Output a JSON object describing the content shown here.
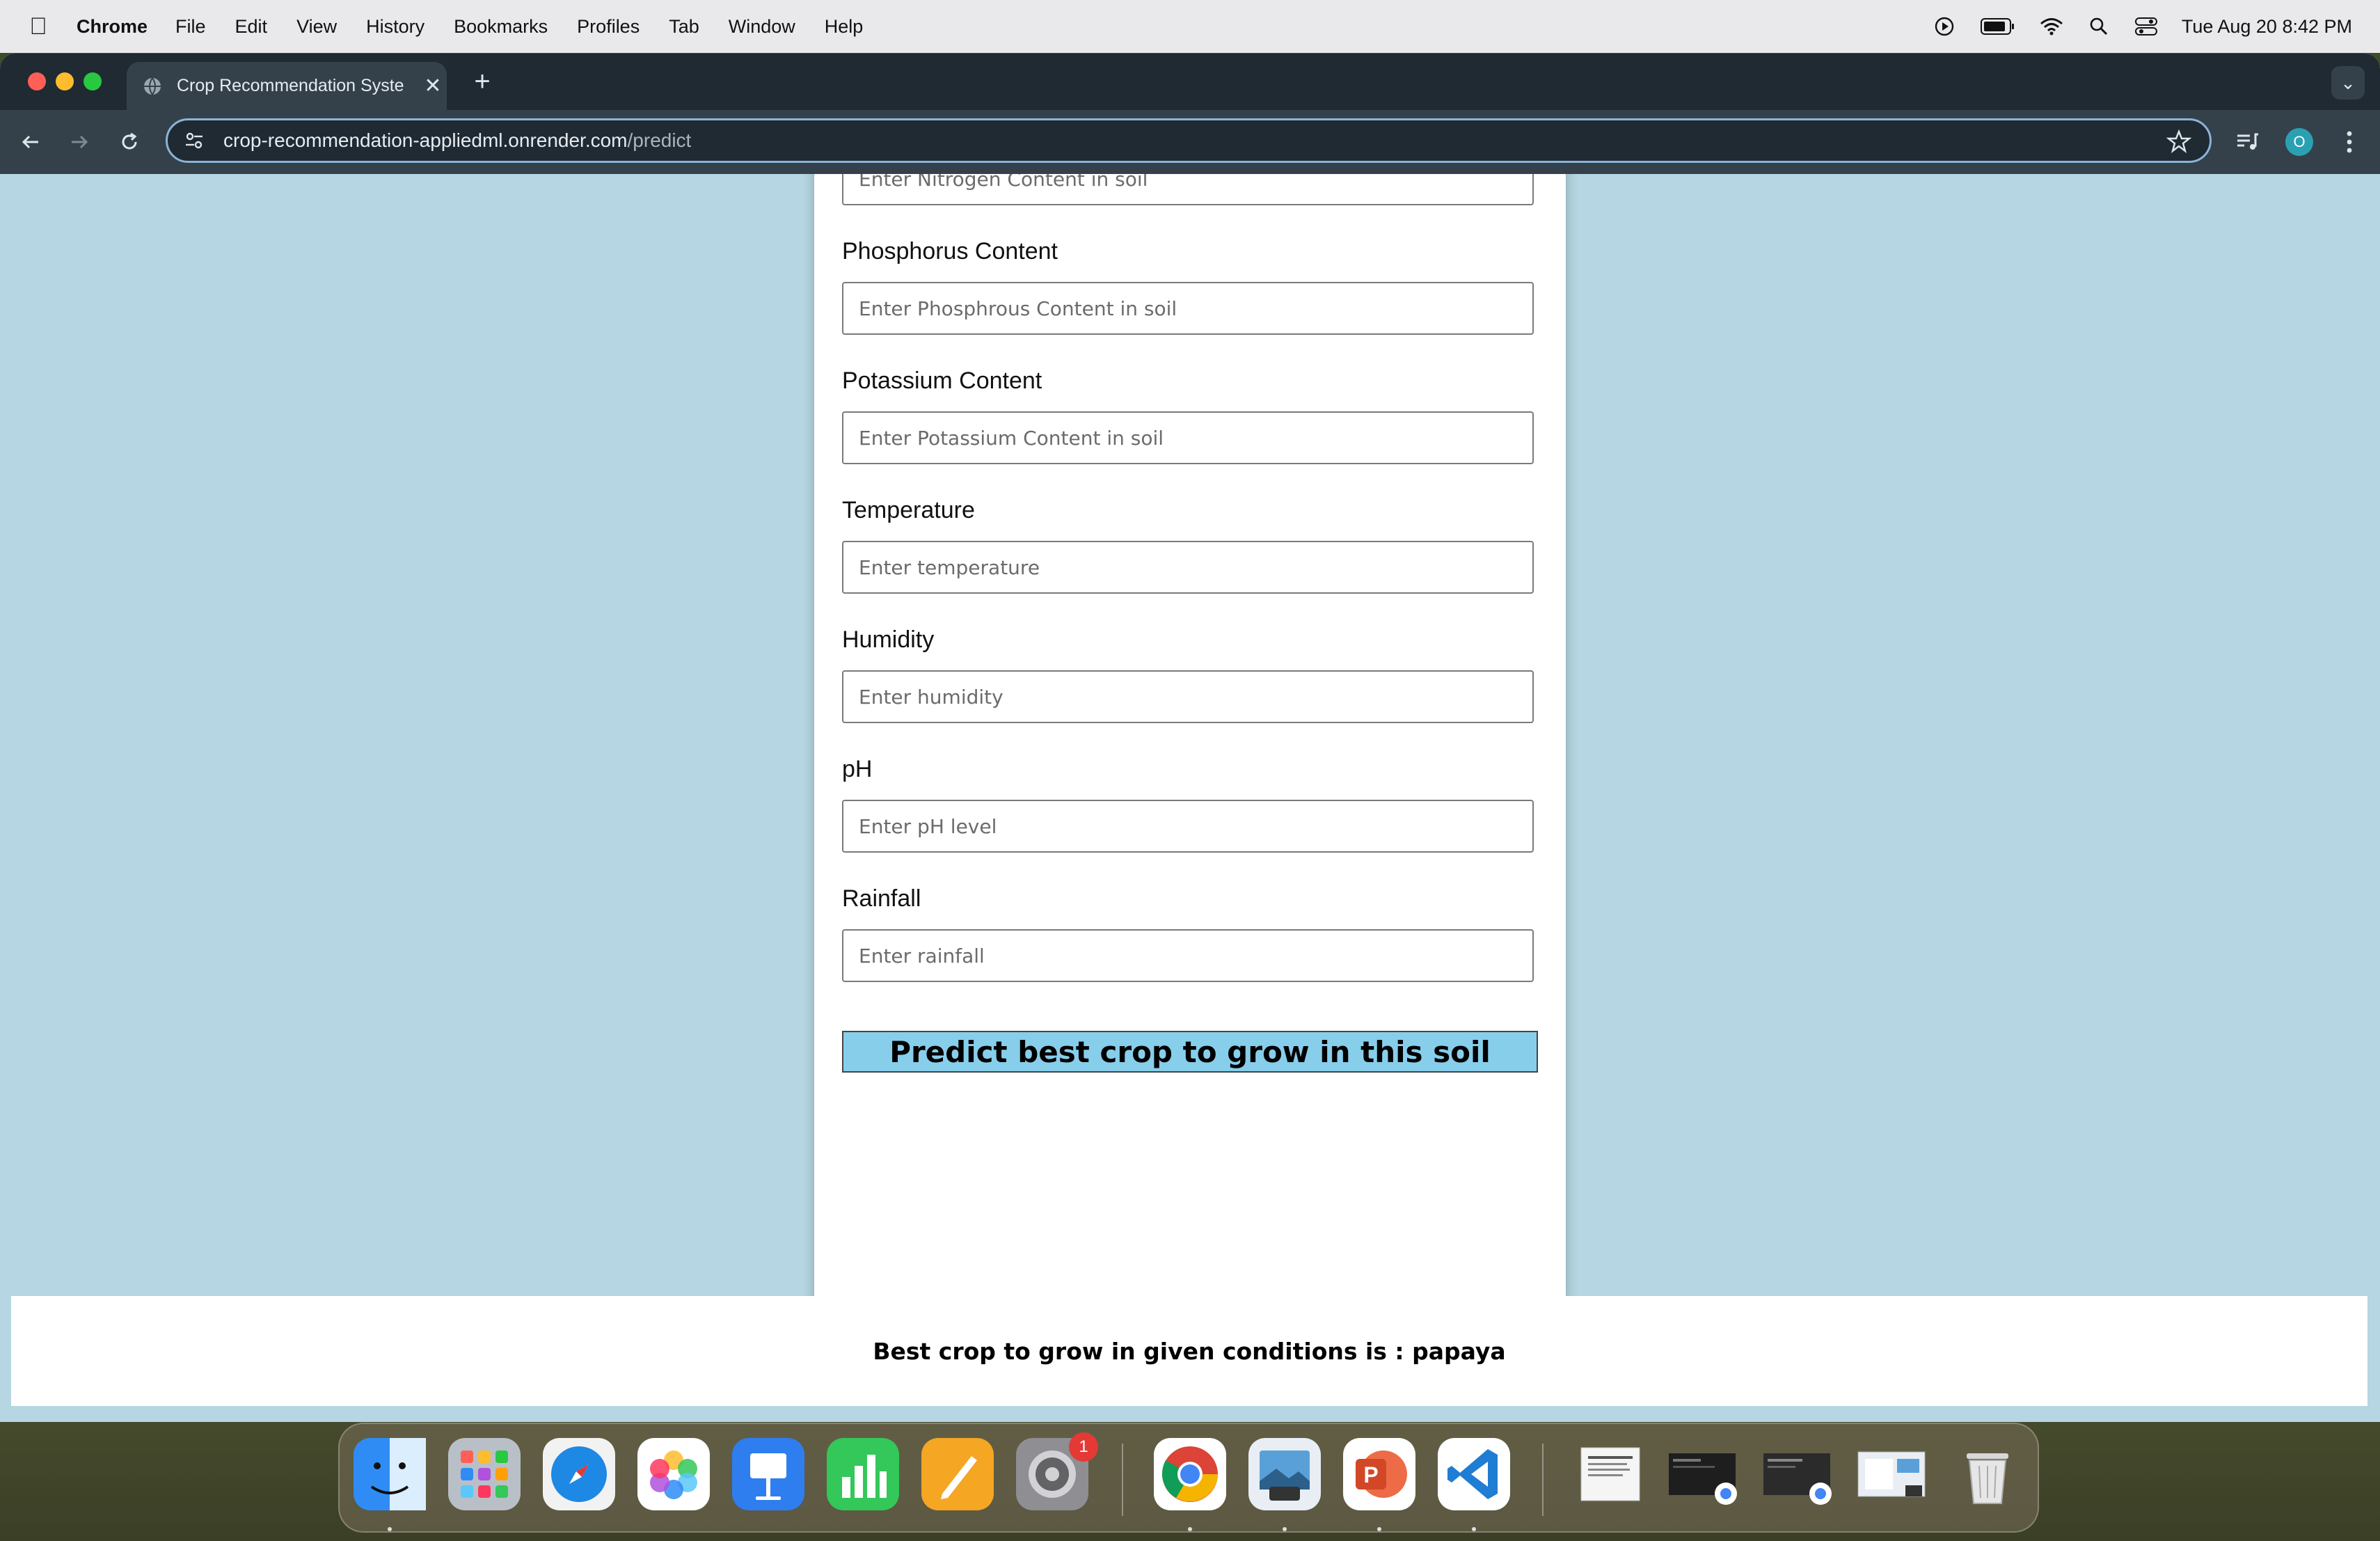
{
  "menubar": {
    "app_name": "Chrome",
    "items": [
      "File",
      "Edit",
      "View",
      "History",
      "Bookmarks",
      "Profiles",
      "Tab",
      "Window",
      "Help"
    ],
    "clock": "Tue Aug 20  8:42 PM"
  },
  "browser": {
    "tab_title": "Crop Recommendation Syste",
    "url_host": "crop-recommendation-appliedml.onrender.com",
    "url_path": "/predict",
    "profile_initial": "O"
  },
  "form": {
    "nitrogen": {
      "placeholder": "Enter Nitrogen Content in soil"
    },
    "phosphorus": {
      "label": "Phosphorus Content",
      "placeholder": "Enter Phosphrous Content in soil"
    },
    "potassium": {
      "label": "Potassium Content",
      "placeholder": "Enter Potassium Content in soil"
    },
    "temperature": {
      "label": "Temperature",
      "placeholder": "Enter temperature"
    },
    "humidity": {
      "label": "Humidity",
      "placeholder": "Enter humidity"
    },
    "ph": {
      "label": "pH",
      "placeholder": "Enter pH level"
    },
    "rainfall": {
      "label": "Rainfall",
      "placeholder": "Enter rainfall"
    },
    "submit_label": "Predict best crop to grow in this soil"
  },
  "result": {
    "text": "Best crop to grow in given conditions is : papaya"
  },
  "dock": {
    "settings_badge": "1",
    "colors": {
      "finder": "#2f8cf5",
      "launchpad": "#b9bfc7",
      "safari": "#1e88e5",
      "photos": "#ffffff",
      "keynote": "#2f7ef0",
      "numbers": "#34c759",
      "pages": "#f5a623",
      "settings": "#8e8e93",
      "chrome": "#ffffff",
      "preview": "#5aa0d8",
      "powerpoint": "#d24726",
      "vscode": "#1f7dd3"
    }
  }
}
